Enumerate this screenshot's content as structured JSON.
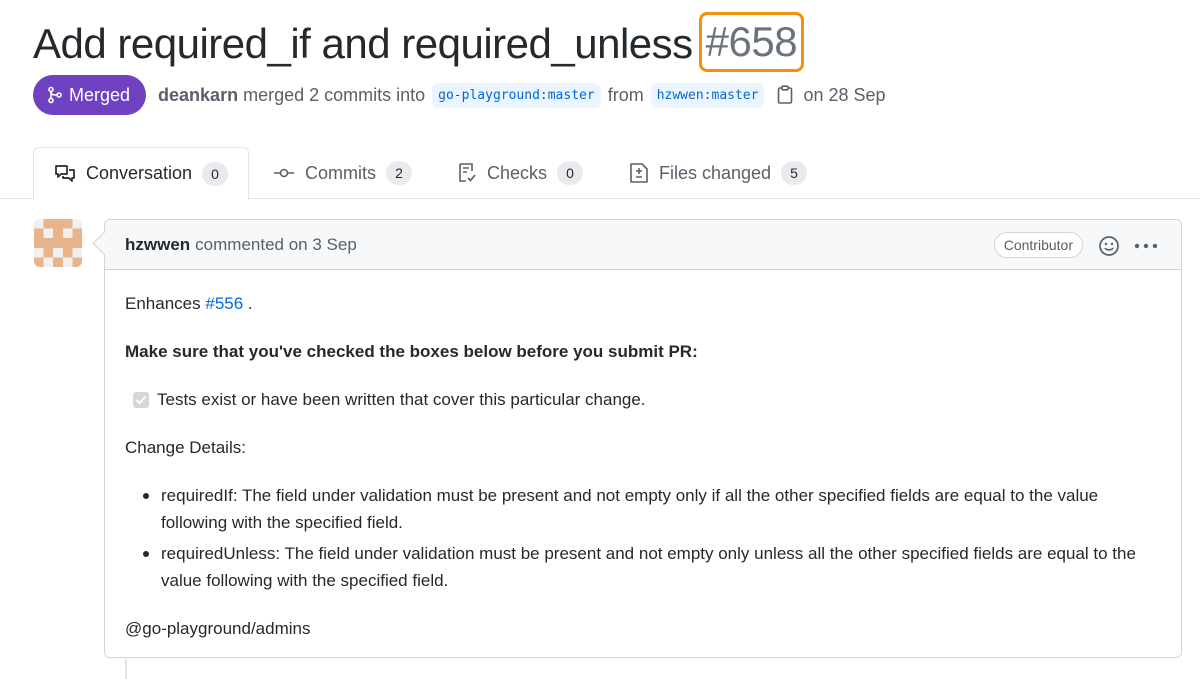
{
  "pr": {
    "title": "Add required_if and required_unless",
    "number": "#658",
    "state": "Merged",
    "author": "deankarn",
    "merge_text": "merged 2 commits into",
    "base_branch": "go-playground:master",
    "from_text": "from",
    "head_branch": "hzwwen:master",
    "date_text": "on 28 Sep"
  },
  "tabs": [
    {
      "label": "Conversation",
      "count": "0"
    },
    {
      "label": "Commits",
      "count": "2"
    },
    {
      "label": "Checks",
      "count": "0"
    },
    {
      "label": "Files changed",
      "count": "5"
    }
  ],
  "comment": {
    "author": "hzwwen",
    "date_text": "commented on 3 Sep",
    "role": "Contributor",
    "intro_prefix": "Enhances",
    "intro_link": "#556",
    "intro_suffix": ".",
    "checklist_heading": "Make sure that you've checked the boxes below before you submit PR:",
    "task_label": "Tests exist or have been written that cover this particular change.",
    "task_checked": true,
    "details_heading": "Change Details:",
    "details": [
      "requiredIf: The field under validation must be present and not empty only if all the other specified fields are equal to the value following with the specified field.",
      "requiredUnless: The field under validation must be present and not empty only unless all the other specified fields are equal to the value following with the specified field."
    ],
    "mention": "@go-playground/admins"
  },
  "colors": {
    "merged": "#6f42c1",
    "link": "#0366d6",
    "highlight": "#f4900c"
  }
}
